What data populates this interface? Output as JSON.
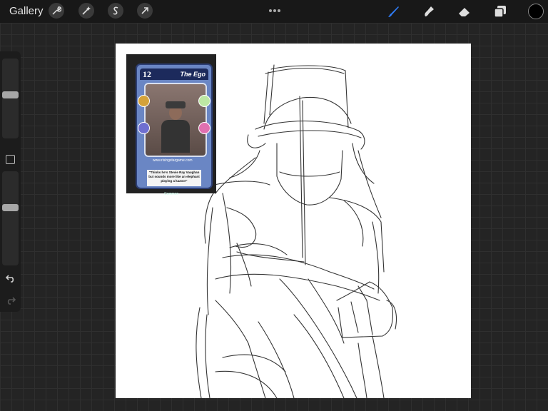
{
  "toolbar": {
    "gallery_label": "Gallery",
    "actions": [
      "wrench-icon",
      "magic-wand-icon",
      "selection-s-icon",
      "transform-arrow-icon"
    ],
    "tools": [
      "brush-icon",
      "smudge-icon",
      "eraser-icon",
      "layers-icon"
    ],
    "active_tool": "brush-icon",
    "active_color": "#000000",
    "accent": "#2f7cf6"
  },
  "sidebar": {
    "brush_size_level": 0.55,
    "opacity_level": 0.62
  },
  "reference_card": {
    "number": "12",
    "title": "The Ego",
    "website": "www.risingstargame.com",
    "quote": "\"Thinks he's Stevie Ray Vaughan but sounds more like an elephant playing a kazoo!\"",
    "rarity": "Common"
  }
}
